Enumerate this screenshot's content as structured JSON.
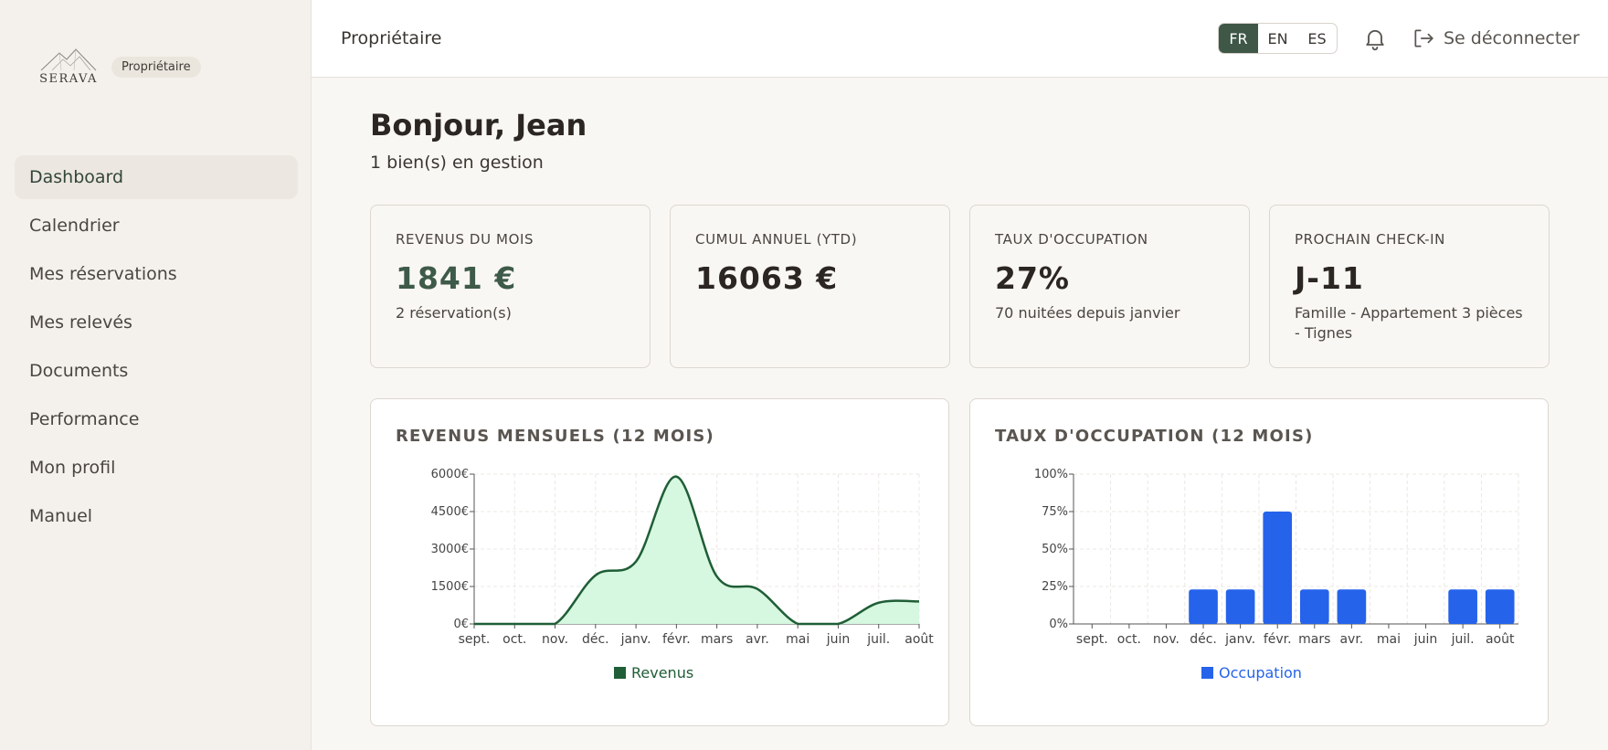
{
  "brand": {
    "logo_text": "SERAVA",
    "role_badge": "Propriétaire"
  },
  "sidebar": {
    "items": [
      {
        "label": "Dashboard",
        "active": true
      },
      {
        "label": "Calendrier"
      },
      {
        "label": "Mes réservations"
      },
      {
        "label": "Mes relevés"
      },
      {
        "label": "Documents"
      },
      {
        "label": "Performance"
      },
      {
        "label": "Mon profil"
      },
      {
        "label": "Manuel"
      }
    ]
  },
  "topbar": {
    "title": "Propriétaire",
    "languages": [
      "FR",
      "EN",
      "ES"
    ],
    "active_language": "FR",
    "logout_label": "Se déconnecter"
  },
  "main": {
    "greeting": "Bonjour, Jean",
    "subtitle": "1 bien(s) en gestion",
    "cards": [
      {
        "label": "REVENUS DU MOIS",
        "value": "1841 €",
        "sub": "2 réservation(s)"
      },
      {
        "label": "CUMUL ANNUEL (YTD)",
        "value": "16063 €",
        "sub": ""
      },
      {
        "label": "TAUX D'OCCUPATION",
        "value": "27%",
        "sub": "70 nuitées depuis janvier"
      },
      {
        "label": "PROCHAIN CHECK-IN",
        "value": "J-11",
        "sub": "Famille - Appartement 3 pièces - Tignes"
      }
    ]
  },
  "colors": {
    "accent": "#3e5747",
    "revenue_line": "#1f5e36",
    "revenue_fill": "#d6f7e0",
    "occupancy_bar": "#2563eb"
  },
  "chart_data": [
    {
      "type": "area",
      "title": "REVENUS MENSUELS (12 MOIS)",
      "categories": [
        "sept.",
        "oct.",
        "nov.",
        "déc.",
        "janv.",
        "févr.",
        "mars",
        "avr.",
        "mai",
        "juin",
        "juil.",
        "août"
      ],
      "series": [
        {
          "name": "Revenus",
          "values": [
            0,
            0,
            0,
            1950,
            2500,
            5900,
            1900,
            1400,
            0,
            0,
            850,
            900
          ]
        }
      ],
      "y_ticks": [
        "0€",
        "1500€",
        "3000€",
        "4500€",
        "6000€"
      ],
      "ylim": [
        0,
        6000
      ],
      "grid": true,
      "legend": "bottom"
    },
    {
      "type": "bar",
      "title": "TAUX D'OCCUPATION (12 MOIS)",
      "categories": [
        "sept.",
        "oct.",
        "nov.",
        "déc.",
        "janv.",
        "févr.",
        "mars",
        "avr.",
        "mai",
        "juin",
        "juil.",
        "août"
      ],
      "series": [
        {
          "name": "Occupation",
          "values": [
            0,
            0,
            0,
            23,
            23,
            75,
            23,
            23,
            0,
            0,
            23,
            23
          ]
        }
      ],
      "y_ticks": [
        "0%",
        "25%",
        "50%",
        "75%",
        "100%"
      ],
      "ylim": [
        0,
        100
      ],
      "grid": true,
      "legend": "bottom"
    }
  ]
}
